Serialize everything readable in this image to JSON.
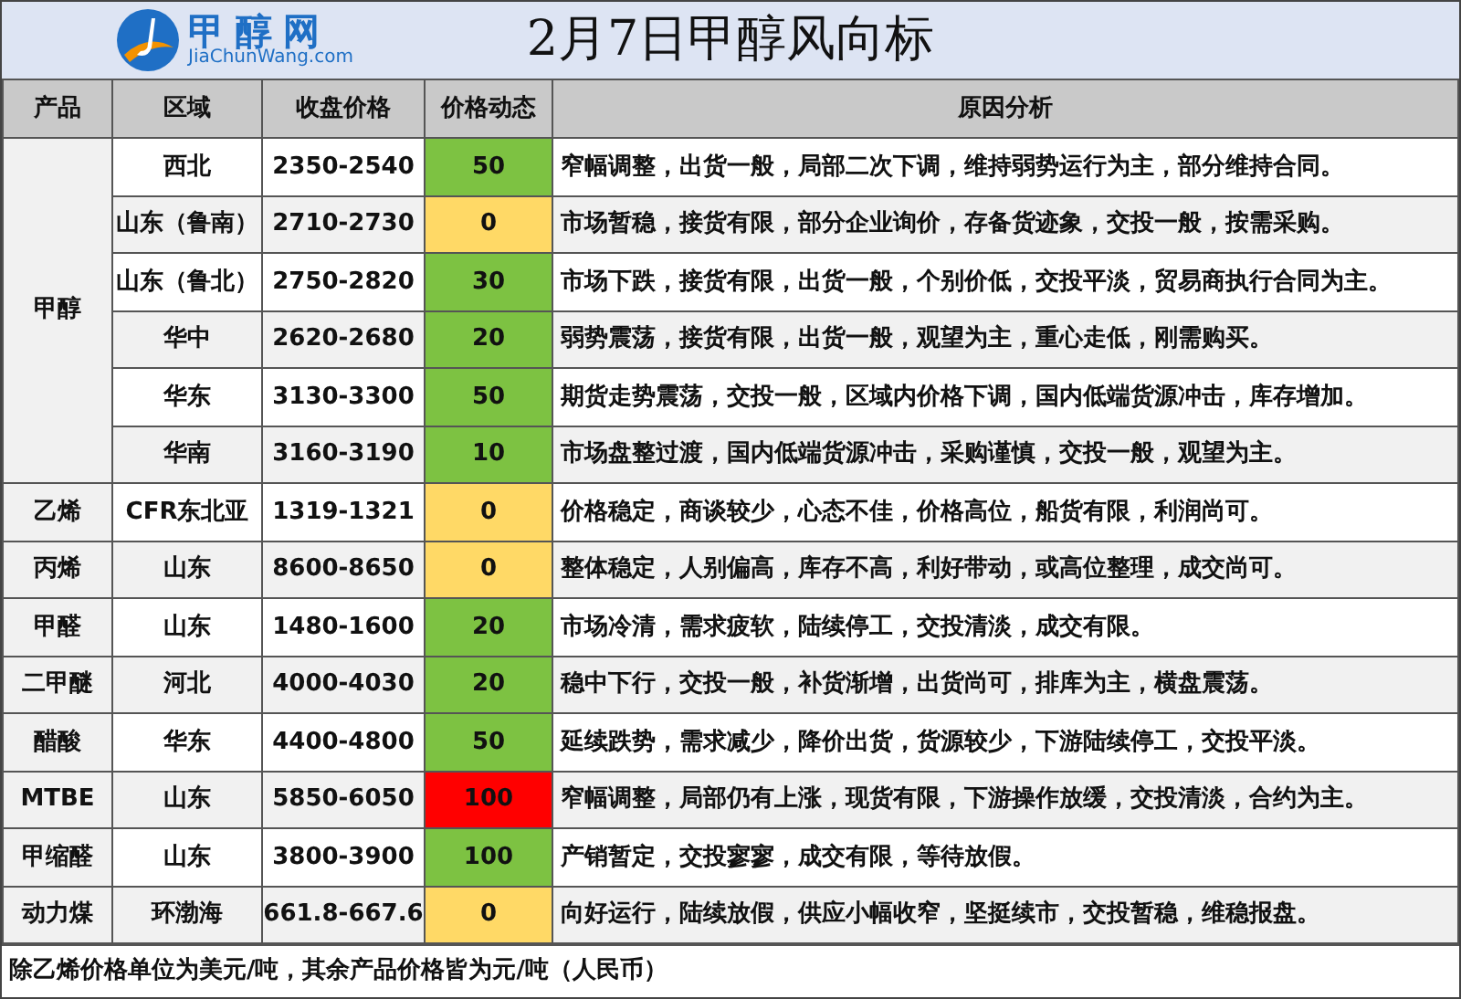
{
  "header": {
    "logo_text": "甲醇网",
    "logo_domain": "JiaChunWang.com",
    "title": "2月7日甲醇风向标"
  },
  "columns": [
    "产品",
    "区域",
    "收盘价格",
    "价格动态",
    "原因分析"
  ],
  "products": [
    {
      "name": "甲醇",
      "rows": [
        {
          "region": "西北",
          "price": "2350-2540",
          "change": "50",
          "color": "#7dc242",
          "reason": "窄幅调整，出货一般，局部二次下调，维持弱势运行为主，部分维持合同。"
        },
        {
          "region": "山东（鲁南）",
          "price": "2710-2730",
          "change": "0",
          "color": "#ffd966",
          "reason": "市场暂稳，接货有限，部分企业询价，存备货迹象，交投一般，按需采购。"
        },
        {
          "region": "山东（鲁北）",
          "price": "2750-2820",
          "change": "30",
          "color": "#7dc242",
          "reason": "市场下跌，接货有限，出货一般，个别价低，交投平淡，贸易商执行合同为主。"
        },
        {
          "region": "华中",
          "price": "2620-2680",
          "change": "20",
          "color": "#7dc242",
          "reason": "弱势震荡，接货有限，出货一般，观望为主，重心走低，刚需购买。"
        },
        {
          "region": "华东",
          "price": "3130-3300",
          "change": "50",
          "color": "#7dc242",
          "reason": "期货走势震荡，交投一般，区域内价格下调，国内低端货源冲击，库存增加。"
        },
        {
          "region": "华南",
          "price": "3160-3190",
          "change": "10",
          "color": "#7dc242",
          "reason": "市场盘整过渡，国内低端货源冲击，采购谨慎，交投一般，观望为主。"
        }
      ]
    },
    {
      "name": "乙烯",
      "rows": [
        {
          "region": "CFR东北亚",
          "price": "1319-1321",
          "change": "0",
          "color": "#ffd966",
          "reason": "价格稳定，商谈较少，心态不佳，价格高位，船货有限，利润尚可。"
        }
      ]
    },
    {
      "name": "丙烯",
      "rows": [
        {
          "region": "山东",
          "price": "8600-8650",
          "change": "0",
          "color": "#ffd966",
          "reason": "整体稳定，人别偏高，库存不高，利好带动，或高位整理，成交尚可。"
        }
      ]
    },
    {
      "name": "甲醛",
      "rows": [
        {
          "region": "山东",
          "price": "1480-1600",
          "change": "20",
          "color": "#7dc242",
          "reason": "市场冷清，需求疲软，陆续停工，交投清淡，成交有限。"
        }
      ]
    },
    {
      "name": "二甲醚",
      "rows": [
        {
          "region": "河北",
          "price": "4000-4030",
          "change": "20",
          "color": "#7dc242",
          "reason": "稳中下行，交投一般，补货渐增，出货尚可，排库为主，横盘震荡。"
        }
      ]
    },
    {
      "name": "醋酸",
      "rows": [
        {
          "region": "华东",
          "price": "4400-4800",
          "change": "50",
          "color": "#7dc242",
          "reason": "延续跌势，需求减少，降价出货，货源较少，下游陆续停工，交投平淡。"
        }
      ]
    },
    {
      "name": "MTBE",
      "rows": [
        {
          "region": "山东",
          "price": "5850-6050",
          "change": "100",
          "color": "#ff0000",
          "reason": "窄幅调整，局部仍有上涨，现货有限，下游操作放缓，交投清淡，合约为主。"
        }
      ]
    },
    {
      "name": "甲缩醛",
      "rows": [
        {
          "region": "山东",
          "price": "3800-3900",
          "change": "100",
          "color": "#7dc242",
          "reason": "产销暂定，交投寥寥，成交有限，等待放假。"
        }
      ]
    },
    {
      "name": "动力煤",
      "rows": [
        {
          "region": "环渤海",
          "price": "661.8-667.6",
          "change": "0",
          "color": "#ffd966",
          "reason": "向好运行，陆续放假，供应小幅收窄，坚挺续市，交投暂稳，维稳报盘。"
        }
      ]
    }
  ],
  "footnote": "除乙烯价格单位为美元/吨，其余产品价格皆为元/吨（人民币）"
}
